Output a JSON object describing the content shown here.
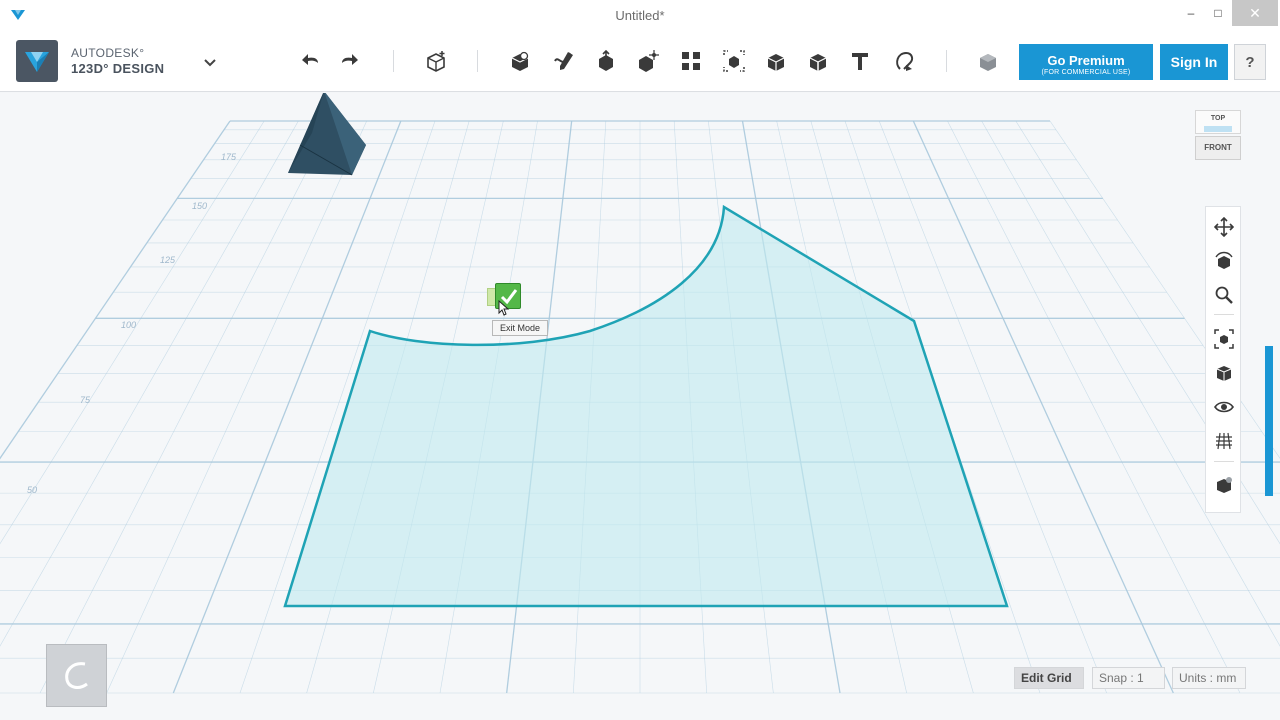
{
  "window": {
    "title": "Untitled*",
    "minimize_glyph": "–",
    "maximize_glyph": "□",
    "close_glyph": "✕"
  },
  "brand": {
    "line1": "AUTODESK°",
    "line2": "123D° DESIGN"
  },
  "toolbar": {
    "tools": [
      "undo-icon",
      "redo-icon",
      "add-primitive-icon",
      "primitives-icon",
      "sketch-icon",
      "construct-icon",
      "modify-icon",
      "pattern-icon",
      "grouping-icon",
      "combine-icon",
      "measure-icon",
      "text-icon",
      "snap-icon",
      "material-icon"
    ],
    "go_premium_label": "Go Premium",
    "go_premium_sub": "(FOR COMMERCIAL USE)",
    "sign_in_label": "Sign In",
    "help_label": "?"
  },
  "viewport": {
    "grid_labels": [
      "175",
      "150",
      "125",
      "100",
      "75",
      "50"
    ],
    "tooltip_text": "Exit Mode",
    "sketch_fill": "#bfe9ee",
    "sketch_stroke": "#1fa3b5",
    "solid_color": "#2f4f63"
  },
  "viewcube": {
    "top_label": "TOP",
    "front_label": "FRONT"
  },
  "navbar": {
    "tools": [
      "pan-icon",
      "orbit-icon",
      "zoom-icon",
      "fit-icon",
      "views-icon",
      "visibility-icon",
      "grid-toggle-icon",
      "materials-icon"
    ]
  },
  "status": {
    "edit_grid_label": "Edit Grid",
    "snap_label": "Snap : 1",
    "units_label": "Units : mm"
  },
  "colors": {
    "accent": "#1a96d4",
    "grid": "#a8c8dc",
    "check_green": "#54b848"
  }
}
